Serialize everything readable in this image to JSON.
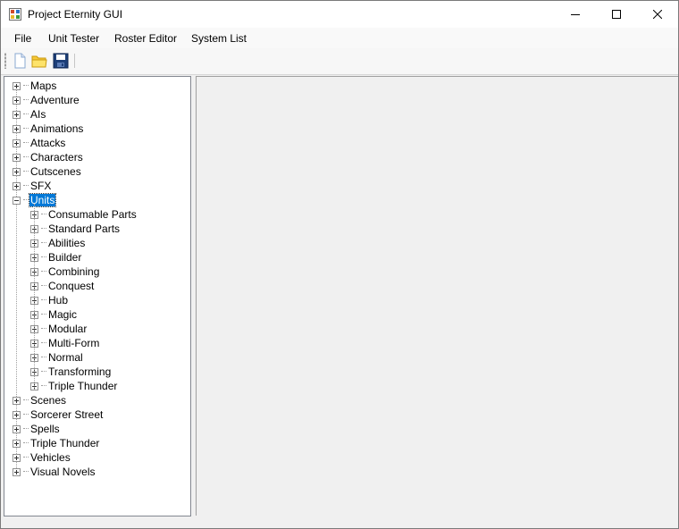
{
  "window": {
    "title": "Project Eternity GUI"
  },
  "menu": [
    "File",
    "Unit Tester",
    "Roster Editor",
    "System List"
  ],
  "toolbar": {
    "buttons": [
      "new-document-icon",
      "open-folder-icon",
      "save-disk-icon"
    ]
  },
  "tree": {
    "items": [
      {
        "label": "Maps",
        "expanded": false
      },
      {
        "label": "Adventure",
        "expanded": false
      },
      {
        "label": "AIs",
        "expanded": false
      },
      {
        "label": "Animations",
        "expanded": false
      },
      {
        "label": "Attacks",
        "expanded": false
      },
      {
        "label": "Characters",
        "expanded": false
      },
      {
        "label": "Cutscenes",
        "expanded": false
      },
      {
        "label": "SFX",
        "expanded": false
      },
      {
        "label": "Units",
        "expanded": true,
        "selected": true,
        "children": [
          "Consumable Parts",
          "Standard Parts",
          "Abilities",
          "Builder",
          "Combining",
          "Conquest",
          "Hub",
          "Magic",
          "Modular",
          "Multi-Form",
          "Normal",
          "Transforming",
          "Triple Thunder"
        ]
      },
      {
        "label": "Scenes",
        "expanded": false
      },
      {
        "label": "Sorcerer Street",
        "expanded": false
      },
      {
        "label": "Spells",
        "expanded": false
      },
      {
        "label": "Triple Thunder",
        "expanded": false
      },
      {
        "label": "Vehicles",
        "expanded": false
      },
      {
        "label": "Visual Novels",
        "expanded": false
      }
    ]
  }
}
